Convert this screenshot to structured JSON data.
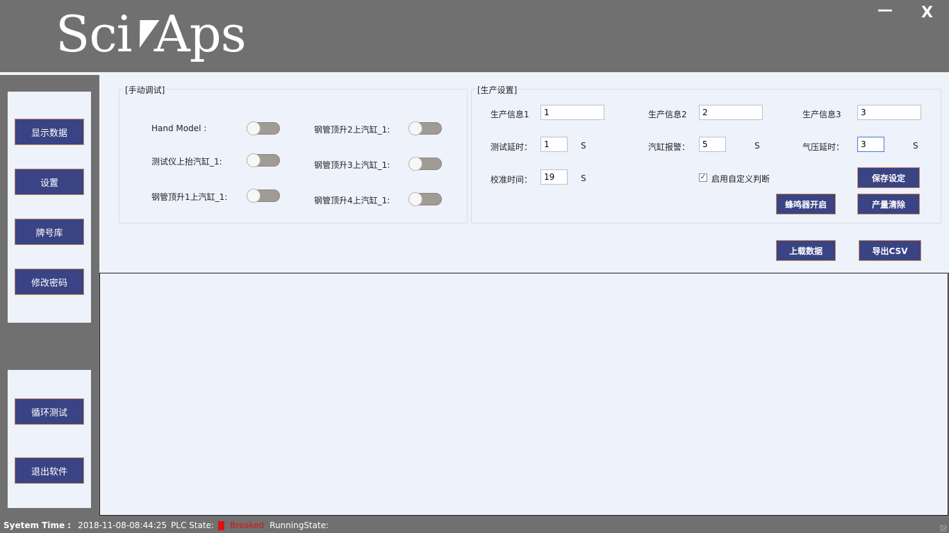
{
  "app": {
    "logo": {
      "left": "Sci",
      "right": "Aps"
    },
    "minimize_label": "—",
    "close_label": "X"
  },
  "sidebar": {
    "top_items": [
      "显示数据",
      "设置",
      "牌号库",
      "修改密码"
    ],
    "bottom_items": [
      "循环测试",
      "退出软件"
    ]
  },
  "manual_debug": {
    "title": "[手动调试]",
    "toggles": [
      {
        "label": "Hand Model :",
        "on": false
      },
      {
        "label": "测试仪上抬汽缸_1:",
        "on": false
      },
      {
        "label": "钢管顶升1上汽缸_1:",
        "on": false
      },
      {
        "label": "钢管顶升2上汽缸_1:",
        "on": false
      },
      {
        "label": "钢管顶升3上汽缸_1:",
        "on": false
      },
      {
        "label": "钢管顶升4上汽缸_1:",
        "on": false
      }
    ]
  },
  "production_settings": {
    "title": "[生产设置]",
    "info1": {
      "label": "生产信息1",
      "value": "1"
    },
    "info2": {
      "label": "生产信息2",
      "value": "2"
    },
    "info3": {
      "label": "生产信息3",
      "value": "3"
    },
    "test_delay": {
      "label": "测试延时：",
      "value": "1",
      "unit": "S"
    },
    "cylinder_alarm": {
      "label": "汽缸报警：",
      "value": "5",
      "unit": "S"
    },
    "pressure_delay": {
      "label": "气压延时：",
      "value": "3",
      "unit": "S"
    },
    "calibration_time": {
      "label": "校准时间：",
      "value": "19",
      "unit": "S"
    },
    "custom_judgment": {
      "label": "启用自定义判断",
      "checked": true,
      "mark": "✓"
    },
    "save_label": "保存设定",
    "buzzer_label": "蜂鸣器开启",
    "clear_output_label": "产量清除"
  },
  "actions": {
    "upload_label": "上载数据",
    "export_label": "导出CSV"
  },
  "status": {
    "system_time_label": "Syetem Time :",
    "system_time": "2018-11-08-08:44:25",
    "plc_state_label": "PLC State:",
    "plc_state": "Breaked",
    "plc_state_color": "#e01010",
    "running_state_label": "RunningState:"
  },
  "colors": {
    "button_fill": "#3a4383",
    "button_border": "#c98a58",
    "chrome": "#707070",
    "panel": "#eef2fb"
  }
}
